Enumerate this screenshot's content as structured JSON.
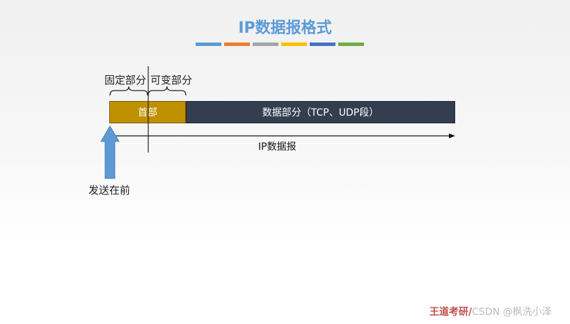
{
  "title": "IP数据报格式",
  "color_bar": [
    "#5b9bd5",
    "#ed7d31",
    "#a5a5a5",
    "#ffc000",
    "#4472c4",
    "#70ad47"
  ],
  "labels": {
    "fixed_part": "固定部分",
    "variable_part": "可变部分",
    "header": "首部",
    "data_part": "数据部分（TCP、UDP段）",
    "ip_datagram": "IP数据报",
    "send_first": "发送在前"
  },
  "watermark": {
    "brand": "王道考研/",
    "text": "CSDN @枫洗小泽"
  }
}
